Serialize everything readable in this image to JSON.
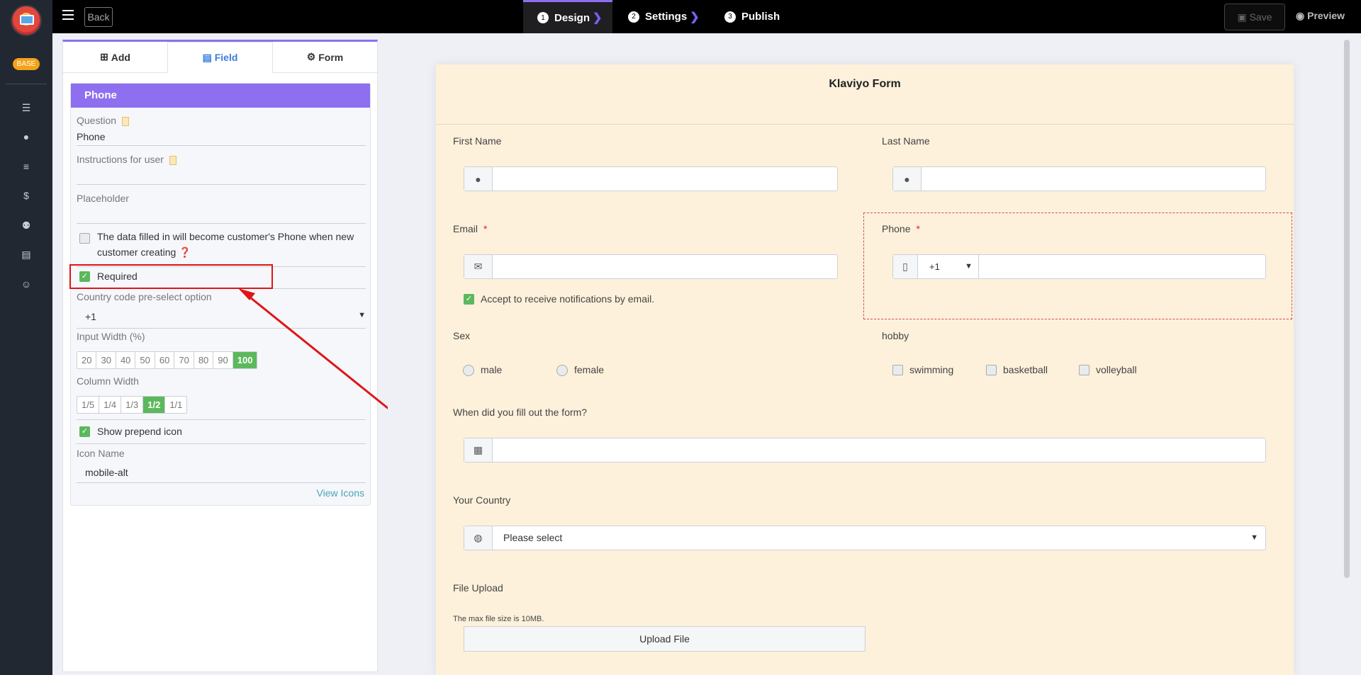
{
  "sidebar": {
    "badge": "BASE",
    "icons": [
      "list-icon",
      "user-icon",
      "menu-icon",
      "dollar-icon",
      "users-icon",
      "file-icon",
      "smile-icon"
    ]
  },
  "topbar": {
    "back_label": "Back",
    "steps": [
      {
        "num": "1",
        "label": "Design"
      },
      {
        "num": "2",
        "label": "Settings"
      },
      {
        "num": "3",
        "label": "Publish"
      }
    ],
    "save_label": "Save",
    "preview_label": "Preview"
  },
  "panel": {
    "tabs": [
      {
        "label": "Add",
        "icon": "plus-square-icon"
      },
      {
        "label": "Field",
        "icon": "list-alt-icon"
      },
      {
        "label": "Form",
        "icon": "gear-icon"
      }
    ],
    "field_title": "Phone",
    "question_label": "Question",
    "question_value": "Phone",
    "instructions_label": "Instructions for user",
    "instructions_value": "",
    "placeholder_label": "Placeholder",
    "placeholder_value": "",
    "customer_phone_text": "The data filled in will become customer's Phone when new customer creating",
    "customer_phone_checked": false,
    "required_label": "Required",
    "required_checked": true,
    "country_code_label": "Country code pre-select option",
    "country_code_value": "+1",
    "input_width_label": "Input Width (%)",
    "input_widths": [
      "20",
      "30",
      "40",
      "50",
      "60",
      "70",
      "80",
      "90",
      "100"
    ],
    "input_width_selected": "100",
    "column_width_label": "Column Width",
    "column_widths": [
      "1/5",
      "1/4",
      "1/3",
      "1/2",
      "1/1"
    ],
    "column_width_selected": "1/2",
    "show_icon_label": "Show prepend icon",
    "show_icon_checked": true,
    "icon_name_label": "Icon Name",
    "icon_name_value": "mobile-alt",
    "view_icons_label": "View Icons"
  },
  "form": {
    "title": "Klaviyo Form",
    "first_name_label": "First Name",
    "last_name_label": "Last Name",
    "email_label": "Email",
    "email_required": "*",
    "phone_label": "Phone",
    "phone_required": "*",
    "phone_country_code": "+1",
    "accept_label": "Accept to receive notifications by email.",
    "sex_label": "Sex",
    "sex_options": [
      "male",
      "female"
    ],
    "hobby_label": "hobby",
    "hobby_options": [
      "swimming",
      "basketball",
      "volleyball"
    ],
    "date_label": "When did you fill out the form?",
    "country_label": "Your Country",
    "country_placeholder": "Please select",
    "upload_label": "File Upload",
    "upload_note": "The max file size is 10MB.",
    "upload_button": "Upload File"
  },
  "colors": {
    "accent": "#8d6ff0",
    "success": "#5cb85c",
    "highlight": "#e01515",
    "form_bg": "#fdf1db"
  }
}
